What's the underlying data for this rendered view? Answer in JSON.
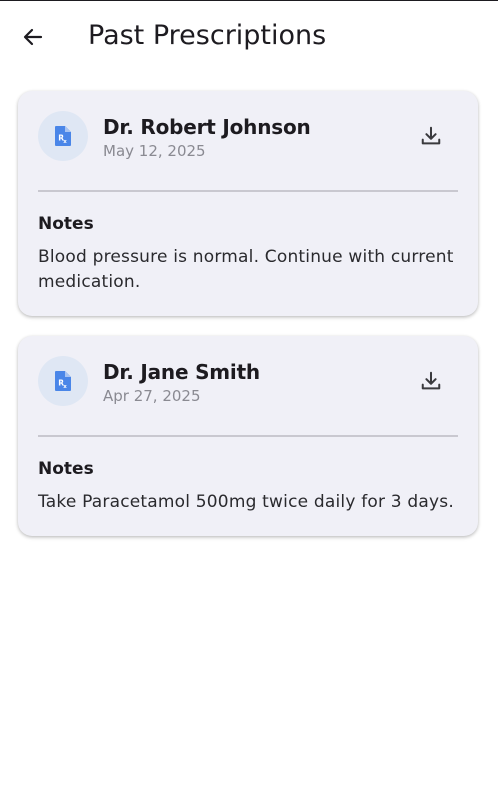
{
  "header": {
    "title": "Past Prescriptions",
    "back_icon": "arrow-left-icon"
  },
  "prescriptions": [
    {
      "doctor": "Dr. Robert Johnson",
      "date": "May 12, 2025",
      "notes_label": "Notes",
      "notes": "Blood pressure is normal. Continue with current medication.",
      "icon": "prescription-rx-icon",
      "action_icon": "download-icon"
    },
    {
      "doctor": "Dr. Jane Smith",
      "date": "Apr 27, 2025",
      "notes_label": "Notes",
      "notes": "Take Paracetamol 500mg twice daily for 3 days.",
      "icon": "prescription-rx-icon",
      "action_icon": "download-icon"
    }
  ],
  "colors": {
    "card_background": "#f0f0f7",
    "icon_accent": "#4a86e8",
    "icon_circle": "#dfe7f4",
    "secondary_text": "#8a8a92"
  }
}
